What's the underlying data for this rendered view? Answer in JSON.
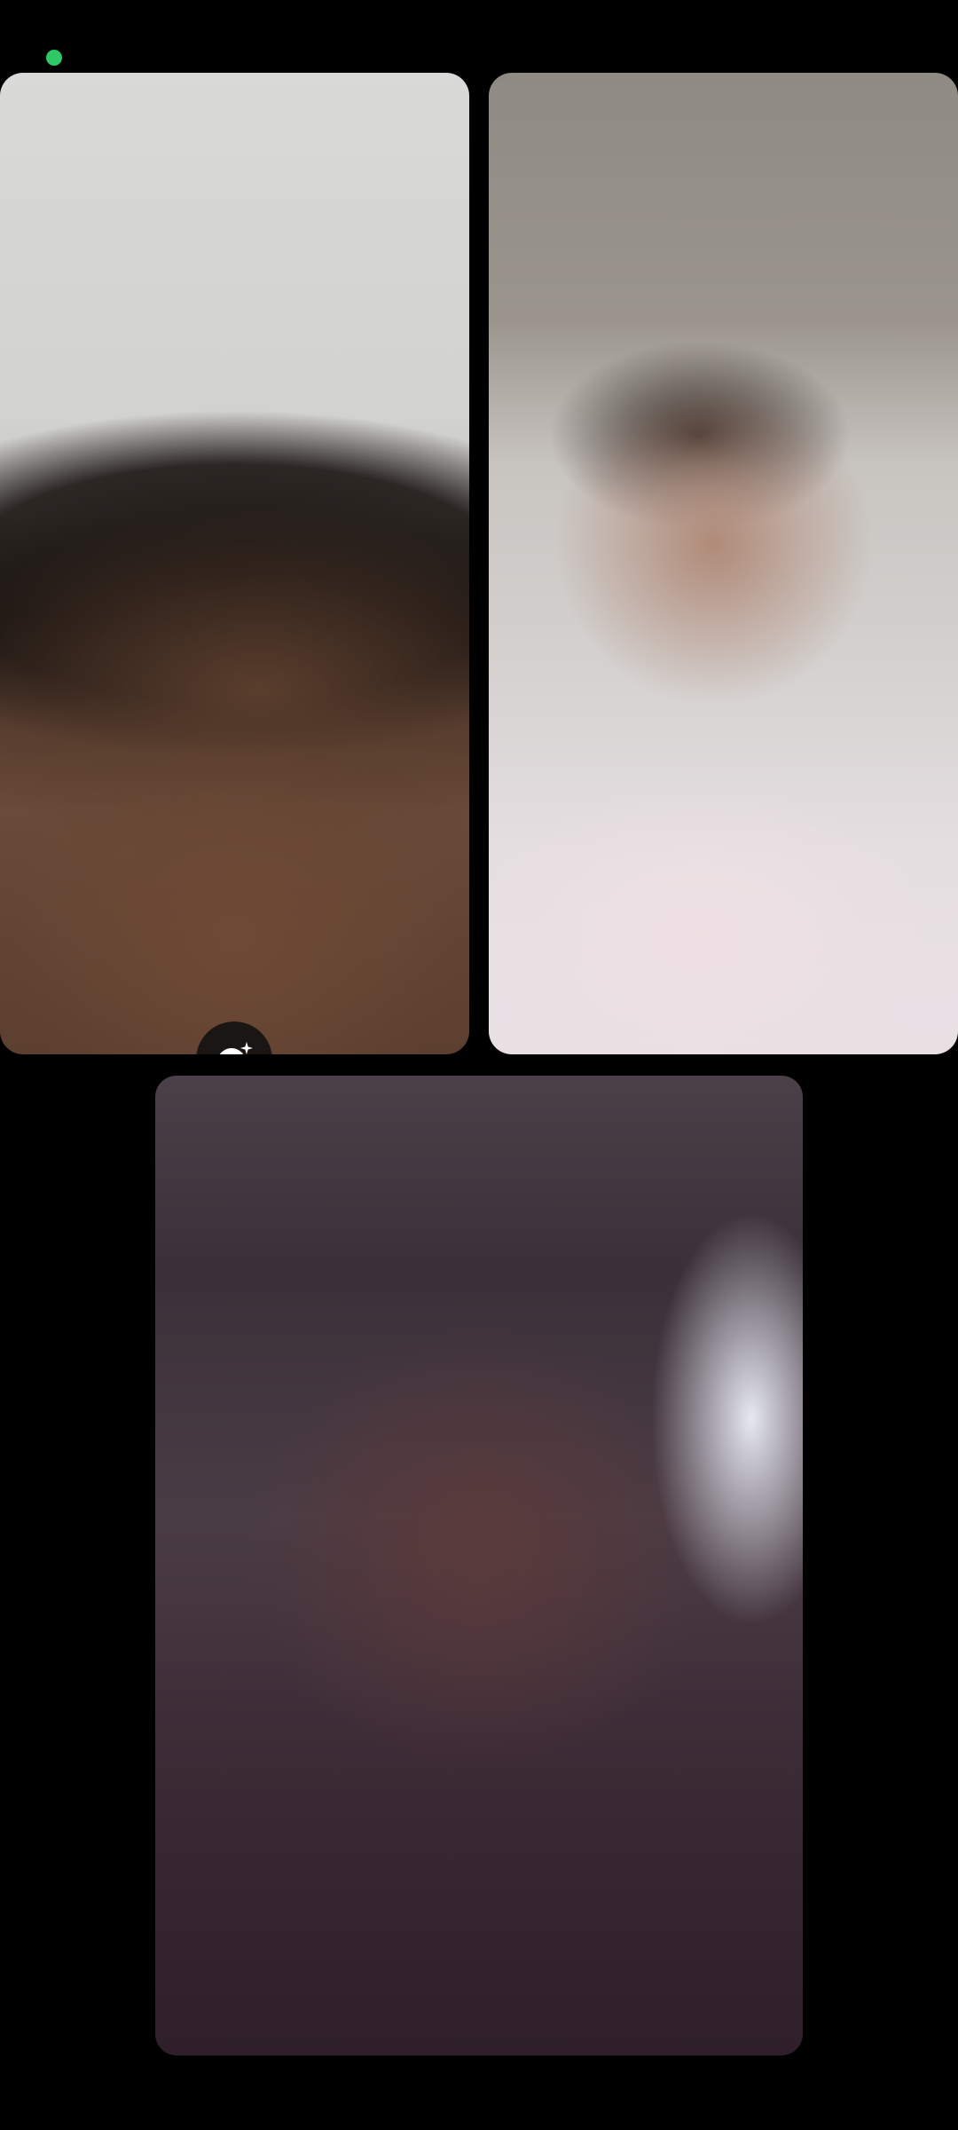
{
  "status": {
    "indicator_color": "#2ec866",
    "indicator_meaning": "active-call"
  },
  "call": {
    "participants": [
      {
        "role": "self",
        "video": "on"
      },
      {
        "role": "remote",
        "video": "on"
      },
      {
        "role": "remote",
        "video": "on"
      }
    ],
    "controls": {
      "effects_button_icon": "smiley-sparkle-icon"
    }
  },
  "colors": {
    "background": "#000000",
    "button_bg": "#1a1614",
    "icon": "#ffffff"
  }
}
